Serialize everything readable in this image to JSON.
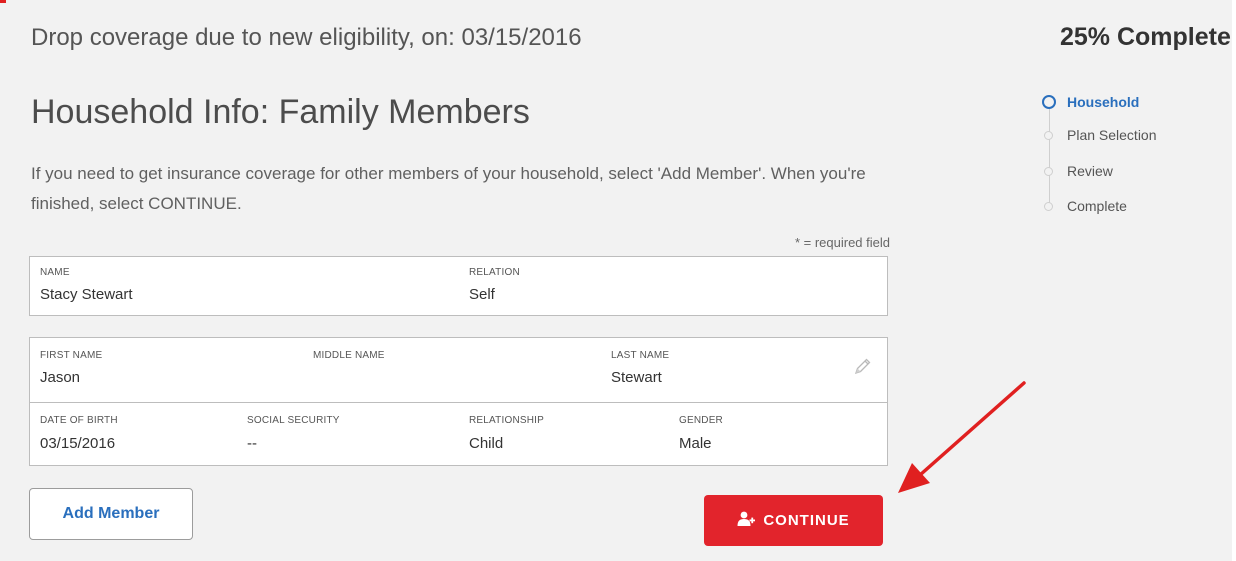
{
  "header": {
    "event_text": "Drop coverage due to new eligibility, on: 03/15/2016",
    "progress_text": "25% Complete"
  },
  "main": {
    "title": "Household Info: Family Members",
    "instructions": "If you need to get insurance coverage for other members of your household, select 'Add Member'. When you're finished, select CONTINUE.",
    "required_note": "* = required field"
  },
  "primary_member": {
    "name_label": "NAME",
    "name": "Stacy Stewart",
    "relation_label": "RELATION",
    "relation": "Self"
  },
  "member": {
    "first_name_label": "FIRST NAME",
    "first_name": "Jason",
    "middle_name_label": "MIDDLE NAME",
    "middle_name": "",
    "last_name_label": "LAST NAME",
    "last_name": "Stewart",
    "dob_label": "DATE OF BIRTH",
    "dob": "03/15/2016",
    "ssn_label": "SOCIAL SECURITY",
    "ssn": "--",
    "relationship_label": "RELATIONSHIP",
    "relationship": "Child",
    "gender_label": "GENDER",
    "gender": "Male"
  },
  "actions": {
    "add_member_label": "Add Member",
    "continue_label": "CONTINUE",
    "continue_icon": "add-user-icon"
  },
  "steps": [
    {
      "label": "Household",
      "active": true
    },
    {
      "label": "Plan Selection",
      "active": false
    },
    {
      "label": "Review",
      "active": false
    },
    {
      "label": "Complete",
      "active": false
    }
  ],
  "colors": {
    "accent_blue": "#2a6fbd",
    "continue_red": "#e2242c",
    "annotation_arrow": "#e02020",
    "panel_bg": "#f2f2f2"
  }
}
